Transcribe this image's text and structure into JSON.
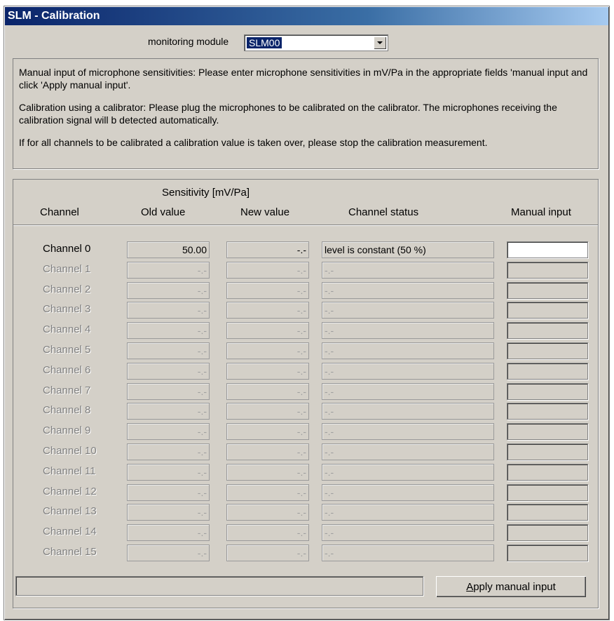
{
  "window": {
    "title": "SLM - Calibration"
  },
  "module": {
    "label": "monitoring module",
    "selected": "SLM00"
  },
  "info": {
    "p1": "Manual input of microphone sensitivities: Please enter microphone sensitivities in mV/Pa in the appropriate fields 'manual input and click 'Apply manual input'.",
    "p2": "Calibration using a calibrator: Please plug the microphones to be calibrated on the calibrator. The microphones receiving the calibration signal will b detected automatically.",
    "p3": "If for all channels to be calibrated a calibration value is taken over, please stop the calibration measurement."
  },
  "table": {
    "sensitivity_header": "Sensitivity [mV/Pa]",
    "col_channel": "Channel",
    "col_old": "Old value",
    "col_new": "New value",
    "col_status": "Channel status",
    "col_manual": "Manual input"
  },
  "channels": [
    {
      "label": "Channel  0",
      "old": "50.00",
      "new": "-.-",
      "status": "level is constant (50 %)",
      "manual": "",
      "active": true
    },
    {
      "label": "Channel  1",
      "old": "-.-",
      "new": "-.-",
      "status": "-.-",
      "manual": "",
      "active": false
    },
    {
      "label": "Channel  2",
      "old": "-.-",
      "new": "-.-",
      "status": "-.-",
      "manual": "",
      "active": false
    },
    {
      "label": "Channel  3",
      "old": "-.-",
      "new": "-.-",
      "status": "-.-",
      "manual": "",
      "active": false
    },
    {
      "label": "Channel  4",
      "old": "-.-",
      "new": "-.-",
      "status": "-.-",
      "manual": "",
      "active": false
    },
    {
      "label": "Channel  5",
      "old": "-.-",
      "new": "-.-",
      "status": "-.-",
      "manual": "",
      "active": false
    },
    {
      "label": "Channel  6",
      "old": "-.-",
      "new": "-.-",
      "status": "-.-",
      "manual": "",
      "active": false
    },
    {
      "label": "Channel  7",
      "old": "-.-",
      "new": "-.-",
      "status": "-.-",
      "manual": "",
      "active": false
    },
    {
      "label": "Channel  8",
      "old": "-.-",
      "new": "-.-",
      "status": "-.-",
      "manual": "",
      "active": false
    },
    {
      "label": "Channel  9",
      "old": "-.-",
      "new": "-.-",
      "status": "-.-",
      "manual": "",
      "active": false
    },
    {
      "label": "Channel 10",
      "old": "-.-",
      "new": "-.-",
      "status": "-.-",
      "manual": "",
      "active": false
    },
    {
      "label": "Channel 11",
      "old": "-.-",
      "new": "-.-",
      "status": "-.-",
      "manual": "",
      "active": false
    },
    {
      "label": "Channel 12",
      "old": "-.-",
      "new": "-.-",
      "status": "-.-",
      "manual": "",
      "active": false
    },
    {
      "label": "Channel 13",
      "old": "-.-",
      "new": "-.-",
      "status": "-.-",
      "manual": "",
      "active": false
    },
    {
      "label": "Channel 14",
      "old": "-.-",
      "new": "-.-",
      "status": "-.-",
      "manual": "",
      "active": false
    },
    {
      "label": "Channel 15",
      "old": "-.-",
      "new": "-.-",
      "status": "-.-",
      "manual": "",
      "active": false
    }
  ],
  "status_text": "",
  "buttons": {
    "apply": "Apply manual input"
  }
}
